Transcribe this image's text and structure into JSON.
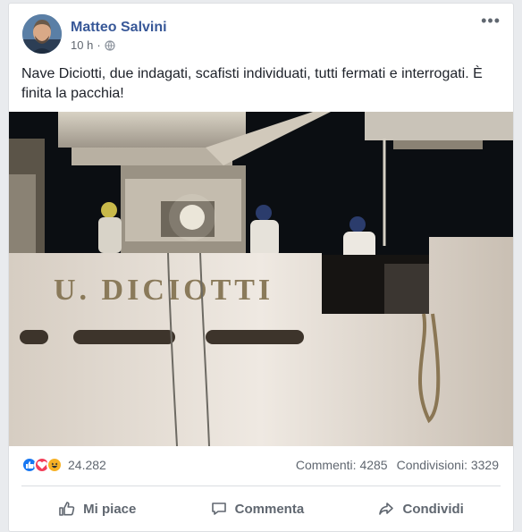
{
  "post": {
    "author": "Matteo Salvini",
    "time": "10 h",
    "separator": "·",
    "privacy_icon": "globe-icon",
    "more_icon": "more-options-icon",
    "text": "Nave Diciotti, due indagati, scafisti individuati, tutti fermati e interrogati. È finita la pacchia!",
    "photo": {
      "ship_name": "U. DICIOTTI",
      "description_icon": "photo-ship"
    }
  },
  "stats": {
    "reactions": [
      "like-icon",
      "love-icon",
      "haha-icon"
    ],
    "reaction_count": "24.282",
    "comments": "Commenti: 4285",
    "shares": "Condivisioni: 3329"
  },
  "actions": {
    "like": "Mi piace",
    "comment": "Commenta",
    "share": "Condividi"
  },
  "colors": {
    "author": "#385898",
    "like": "#1877f2",
    "love": "#f33e58",
    "haha": "#f7b125",
    "muted": "#606770"
  }
}
